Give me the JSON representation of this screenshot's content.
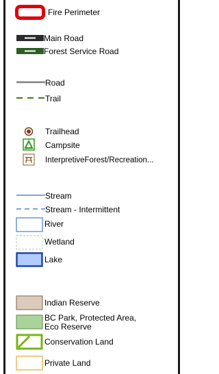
{
  "legend": {
    "fire_perimeter": "Fire Perimeter",
    "main_road": "Main Road",
    "forest_service_road": "Forest Service Road",
    "road": "Road",
    "trail": "Trail",
    "trailhead": "Trailhead",
    "campsite": "Campsite",
    "interpretive": "InterpretiveForest/Recreation...",
    "stream": "Stream",
    "stream_intermittent": "Stream - Intermittent",
    "river": "River",
    "wetland": "Wetland",
    "lake": "Lake",
    "indian_reserve": "Indian Reserve",
    "bc_park": "BC Park, Protected Area, Eco Reserve",
    "conservation_land": "Conservation Land",
    "private_land": "Private Land"
  },
  "colors": {
    "fire_perimeter": "#e0000a",
    "main_road": "#2b2b2b",
    "forest_service_road": "#2e5e24",
    "road": "#808080",
    "trail": "#3a7d1e",
    "trailhead": "#7a3a16",
    "campsite": "#2f9a1c",
    "interpretive": "#8c5a2a",
    "stream": "#7aa6e0",
    "river": "#6f9fdc",
    "wetland": "#b9d7a8",
    "lake_fill": "#b3ccff",
    "lake_stroke": "#1e4aa8",
    "indian_reserve": "#dccbbb",
    "bc_park": "#aad39a",
    "conservation_land": "#7bb21a",
    "private_land": "#e8a83a"
  }
}
